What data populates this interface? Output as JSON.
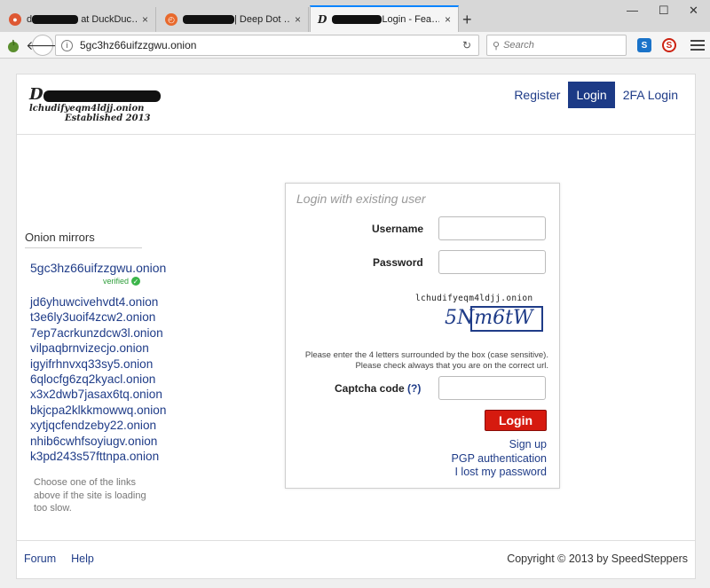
{
  "tabs": [
    {
      "title_suffix": "at DuckDuc…",
      "favicon": "duckduckgo-icon",
      "color": "#de5833"
    },
    {
      "title_suffix": "| Deep Dot …",
      "favicon": "deepdot-icon",
      "color": "#e8692c"
    },
    {
      "title_suffix": "Login - Fea…",
      "favicon": "site-d-icon",
      "color": "#ffffff"
    }
  ],
  "browser": {
    "url": "5gc3hz66uifzzgwu.onion",
    "search_placeholder": "Search",
    "tab_close": "×",
    "new_tab": "+"
  },
  "site": {
    "logo_initial": "D",
    "logo_onion": "lchudifyeqm4ldjj.onion",
    "logo_established": "Established 2013",
    "nav": [
      "Register",
      "Login",
      "2FA Login"
    ]
  },
  "mirrors": {
    "heading": "Onion mirrors",
    "main": "5gc3hz66uifzzgwu.onion",
    "verified_label": "verified",
    "list": [
      "jd6yhuwcivehvdt4.onion",
      "t3e6ly3uoif4zcw2.onion",
      "7ep7acrkunzdcw3l.onion",
      "vilpaqbrnvizecjo.onion",
      "igyifrhnvxq33sy5.onion",
      "6qlocfg6zq2kyacl.onion",
      "x3x2dwb7jasax6tq.onion",
      "bkjcpa2klkkmowwq.onion",
      "xytjqcfendzeby22.onion",
      "nhib6cwhfsoyiugv.onion",
      "k3pd243s57fttnpa.onion"
    ],
    "note": "Choose one of the links above if the site is loading too slow."
  },
  "login": {
    "legend": "Login with existing user",
    "username_label": "Username",
    "password_label": "Password",
    "captcha_header": "lchudifyeqm4ldjj.onion",
    "captcha_code": "5Nm6tW",
    "captcha_help": "Please enter the 4 letters surrounded by the box (case sensitive). Please check always that you are on the correct url.",
    "captcha_label": "Captcha code",
    "captcha_help_link": "(?)",
    "button": "Login",
    "links": [
      "Sign up",
      "PGP authentication",
      "I lost my password"
    ]
  },
  "footer": {
    "links": [
      "Forum",
      "Help"
    ],
    "copyright": "Copyright © 2013 by SpeedSteppers"
  },
  "colors": {
    "link": "#1f3c88",
    "nav_active": "#1c3a86",
    "login_button": "#d61a0f",
    "verified": "#2e9e3a"
  }
}
